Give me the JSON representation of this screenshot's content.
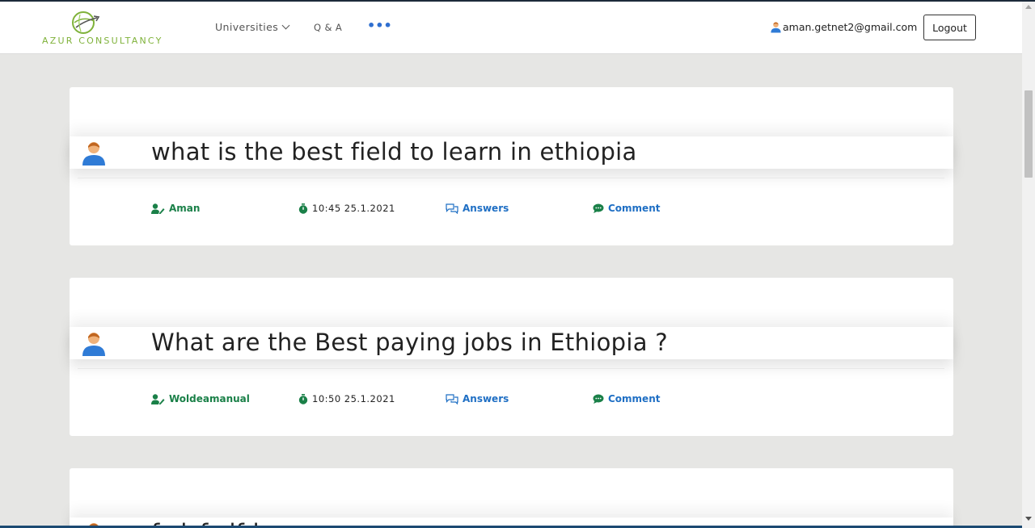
{
  "brand": {
    "name": "AZUR CONSULTANCY",
    "color": "#7fb23a"
  },
  "nav": {
    "universities": "Universities",
    "qa": "Q & A",
    "more": "•••"
  },
  "user": {
    "email": "aman.getnet2@gmail.com",
    "logout": "Logout"
  },
  "colors": {
    "author": "#1a8048",
    "link": "#1f6fc4",
    "background": "#e6e6e4"
  },
  "icons": {
    "avatar": "person-avatar-icon",
    "author": "user-edit-icon",
    "time": "stopwatch-icon",
    "answers": "comments-icon",
    "comment": "comment-bubble-icon"
  },
  "questions": [
    {
      "title": "what is the best field to learn in ethiopia",
      "author": "Aman",
      "time": "10:45 25.1.2021",
      "answers_label": "Answers",
      "comment_label": "Comment"
    },
    {
      "title": "What are the Best paying jobs in Ethiopia ?",
      "author": "Woldeamanual",
      "time": "10:50 25.1.2021",
      "answers_label": "Answers",
      "comment_label": "Comment"
    },
    {
      "title": "fsdsfsdfdss"
    }
  ]
}
